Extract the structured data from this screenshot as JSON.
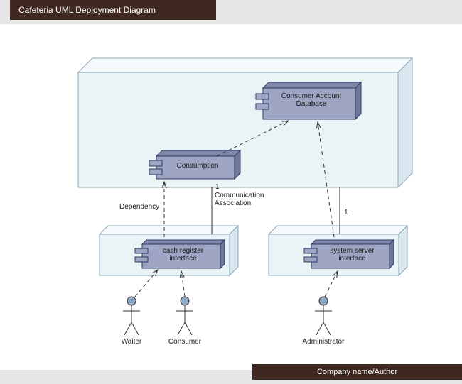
{
  "title": "Cafeteria UML Deployment Diagram",
  "footer": "Company name/Author",
  "components": {
    "consumer_account_db": "Consumer Account\nDatabase",
    "consumption": "Consumption",
    "cash_register_interface": "cash register\ninterface",
    "system_server_interface": "system server\ninterface"
  },
  "labels": {
    "dependency": "Dependency",
    "communication_association": "Communication\nAssociation",
    "multiplicity_top": "1",
    "multiplicity_right": "1"
  },
  "actors": {
    "waiter": "Waiter",
    "consumer": "Consumer",
    "administrator": "Administrator"
  },
  "colors": {
    "node_fill": "#eaf3f6",
    "node_stroke": "#8aa6b5",
    "component_fill": "#9fa6c4",
    "component_side": "#8189ab",
    "component_stroke": "#2d3b66",
    "actor_fill": "#8da8c2"
  }
}
